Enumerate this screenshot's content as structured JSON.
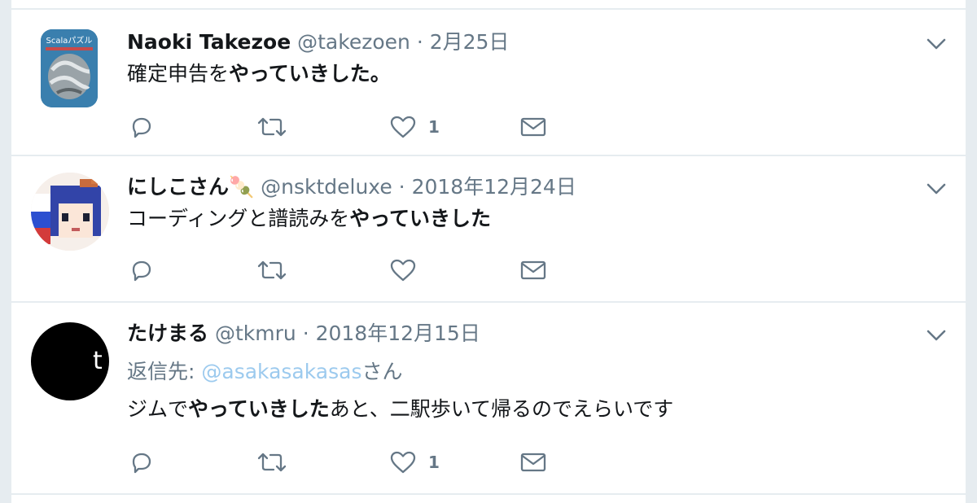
{
  "tweets": [
    {
      "name": "Naoki Takezoe",
      "handle": "@takezoen",
      "separator": "·",
      "date": "2月25日",
      "text_before": "確定申告を",
      "text_bold": "やっていきした。",
      "text_after": "",
      "avatar_label": "Scalaパズル",
      "like_count": "1"
    },
    {
      "name": "にしこさん",
      "name_emoji": "🍡",
      "handle": "@nsktdeluxe",
      "separator": "·",
      "date": "2018年12月24日",
      "text_before": "コーディングと譜読みを",
      "text_bold": "やっていきした",
      "text_after": "",
      "like_count": ""
    },
    {
      "name": "たけまる",
      "handle": "@tkmru",
      "separator": "·",
      "date": "2018年12月15日",
      "reply_prefix": "返信先: ",
      "reply_mention": "@asakasakasas",
      "reply_suffix": "さん",
      "text_before": "ジムで",
      "text_bold": "やっていきした",
      "text_after": "あと、二駅歩いて帰るのでえらいです",
      "avatar_letter": "t",
      "like_count": "1"
    }
  ],
  "icons": {
    "reply": "reply-icon",
    "retweet": "retweet-icon",
    "like": "heart-icon",
    "dm": "envelope-icon",
    "menu": "chevron-down-icon"
  },
  "colors": {
    "icon_gray": "#657786",
    "text": "#14171a",
    "mention": "#9ccaee",
    "divider": "#e6ecf0"
  }
}
